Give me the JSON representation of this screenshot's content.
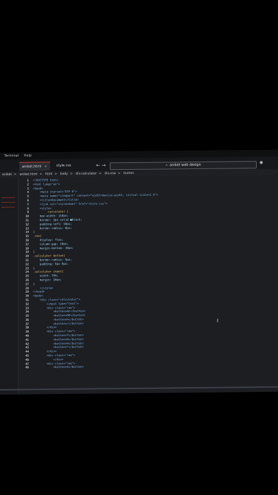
{
  "menubar": {
    "items": [
      "Terminal",
      "Help"
    ]
  },
  "tabs": [
    {
      "label": "aniket.html",
      "close": "×"
    },
    {
      "label": "style.css",
      "close": ""
    }
  ],
  "nav": {
    "back": "←",
    "forward": "→"
  },
  "search": {
    "value": "aniket web design"
  },
  "breadcrumb": [
    "aniket",
    "aniket.html",
    "html",
    "body",
    "div.calculator",
    "div.row",
    "button"
  ],
  "code": [
    {
      "n": "1",
      "t": "<!DOCTYPE html>"
    },
    {
      "n": "2",
      "t": "<html lang=\"en\">"
    },
    {
      "n": "3",
      "t": "<head>"
    },
    {
      "n": "4",
      "t": "    <meta charset=\"UTF-8\">"
    },
    {
      "n": "5",
      "t": "    <meta name=\"viewport\" content=\"width=device-width, initial-scale=1.0\">"
    },
    {
      "n": "6",
      "t": "    <title>Document</title>"
    },
    {
      "n": "7",
      "t": "    <link rel=\"stylesheet\" href=\"style.css\">"
    },
    {
      "n": "8",
      "t": "    <style>"
    },
    {
      "n": "9",
      "t": "        .calculator {"
    },
    {
      "n": "10",
      "t": "    max-width: 110px;"
    },
    {
      "n": "11",
      "t": "    border: 2px solid ■black;"
    },
    {
      "n": "12",
      "t": "    padding-left: 10px;"
    },
    {
      "n": "13",
      "t": "    border-radius: 8px;"
    },
    {
      "n": "14",
      "t": "}"
    },
    {
      "n": "15",
      "t": ".row{"
    },
    {
      "n": "16",
      "t": "    display: flex;"
    },
    {
      "n": "17",
      "t": "    column-gap: 10px;"
    },
    {
      "n": "18",
      "t": "    margin-bottom: 10px;"
    },
    {
      "n": "19",
      "t": "}"
    },
    {
      "n": "20",
      "t": ".calculator button{"
    },
    {
      "n": "21",
      "t": "    border-radius: 5px;"
    },
    {
      "n": "22",
      "t": "    padding: 5px 8px;"
    },
    {
      "n": "23",
      "t": "}"
    },
    {
      "n": "24",
      "t": ".calculator input{"
    },
    {
      "n": "25",
      "t": "    width: 70%;"
    },
    {
      "n": "26",
      "t": "    margin: 10px;"
    },
    {
      "n": "27",
      "t": "}"
    },
    {
      "n": "28",
      "t": "    </style>"
    },
    {
      "n": "29",
      "t": "</head>"
    },
    {
      "n": "30",
      "t": "<body>"
    },
    {
      "n": "31",
      "t": "    <div class=\"calculator\">"
    },
    {
      "n": "32",
      "t": "        <input type=\"text\">"
    },
    {
      "n": "33",
      "t": "        <div class=\"row\">"
    },
    {
      "n": "34",
      "t": "            <button>AC</button>"
    },
    {
      "n": "35",
      "t": "            <button>DE</button>"
    },
    {
      "n": "36",
      "t": "            <button>%</button>"
    },
    {
      "n": "37",
      "t": "            <button>/</button>"
    },
    {
      "n": "38",
      "t": "        </div>"
    },
    {
      "n": "39",
      "t": "        <div class=\"row\">"
    },
    {
      "n": "40",
      "t": "            <button>7</button>"
    },
    {
      "n": "41",
      "t": "            <button>8</button>"
    },
    {
      "n": "42",
      "t": "            <button>9</button>"
    },
    {
      "n": "43",
      "t": "            <button>*</button>"
    },
    {
      "n": "44",
      "t": "        </div>"
    },
    {
      "n": "45",
      "t": "        <div class=\"row\">"
    },
    {
      "n": "46",
      "t": "            </div>"
    },
    {
      "n": "47",
      "t": "        <div class=\"row\">"
    },
    {
      "n": "48",
      "t": "            <button>4</button>"
    }
  ],
  "colors": {
    "accent": "#c0392b",
    "background": "#1c1e22",
    "tag": "#7fb3e3",
    "string": "#e6a26a"
  },
  "icons": {
    "search": "search-icon",
    "cursor": "text-cursor-icon"
  }
}
